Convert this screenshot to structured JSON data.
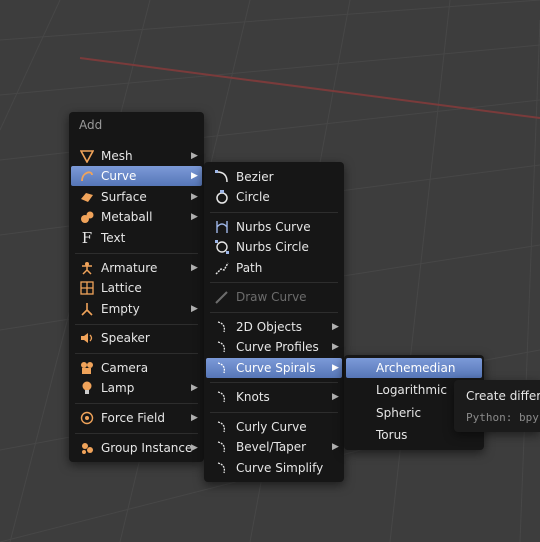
{
  "add_menu": {
    "title": "Add",
    "items": [
      {
        "label": "Mesh",
        "icon": "mesh-icon"
      },
      {
        "label": "Curve",
        "icon": "curve-icon"
      },
      {
        "label": "Surface",
        "icon": "surface-icon"
      },
      {
        "label": "Metaball",
        "icon": "metaball-icon"
      },
      {
        "label": "Text",
        "icon": "text-icon"
      },
      {
        "label": "Armature",
        "icon": "armature-icon"
      },
      {
        "label": "Lattice",
        "icon": "lattice-icon"
      },
      {
        "label": "Empty",
        "icon": "empty-icon"
      },
      {
        "label": "Speaker",
        "icon": "speaker-icon"
      },
      {
        "label": "Camera",
        "icon": "camera-icon"
      },
      {
        "label": "Lamp",
        "icon": "lamp-icon"
      },
      {
        "label": "Force Field",
        "icon": "force-field-icon"
      },
      {
        "label": "Group Instance",
        "icon": "group-instance-icon"
      }
    ]
  },
  "curve_menu": {
    "items": [
      {
        "label": "Bezier",
        "icon": "bezier-curve-icon"
      },
      {
        "label": "Circle",
        "icon": "bezier-circle-icon"
      },
      {
        "label": "Nurbs Curve",
        "icon": "nurbs-curve-icon"
      },
      {
        "label": "Nurbs Circle",
        "icon": "nurbs-circle-icon"
      },
      {
        "label": "Path",
        "icon": "path-icon"
      },
      {
        "label": "Draw Curve",
        "icon": "draw-curve-icon"
      },
      {
        "label": "2D Objects",
        "icon": "curve-small-icon"
      },
      {
        "label": "Curve Profiles",
        "icon": "curve-small-icon"
      },
      {
        "label": "Curve Spirals",
        "icon": "curve-small-icon"
      },
      {
        "label": "Knots",
        "icon": "curve-small-icon"
      },
      {
        "label": "Curly Curve",
        "icon": "curve-small-icon"
      },
      {
        "label": "Bevel/Taper",
        "icon": "curve-small-icon"
      },
      {
        "label": "Curve Simplify",
        "icon": "curve-small-icon"
      }
    ]
  },
  "spirals_menu": {
    "items": [
      {
        "label": "Archemedian"
      },
      {
        "label": "Logarithmic"
      },
      {
        "label": "Spheric"
      },
      {
        "label": "Torus"
      }
    ]
  },
  "tooltip": {
    "text": "Create differe",
    "python": "Python: bpy"
  },
  "colors": {
    "highlight": "#6a88c6",
    "icon_orange": "#f0a35a",
    "viewport_bg": "#3d3d3d"
  }
}
